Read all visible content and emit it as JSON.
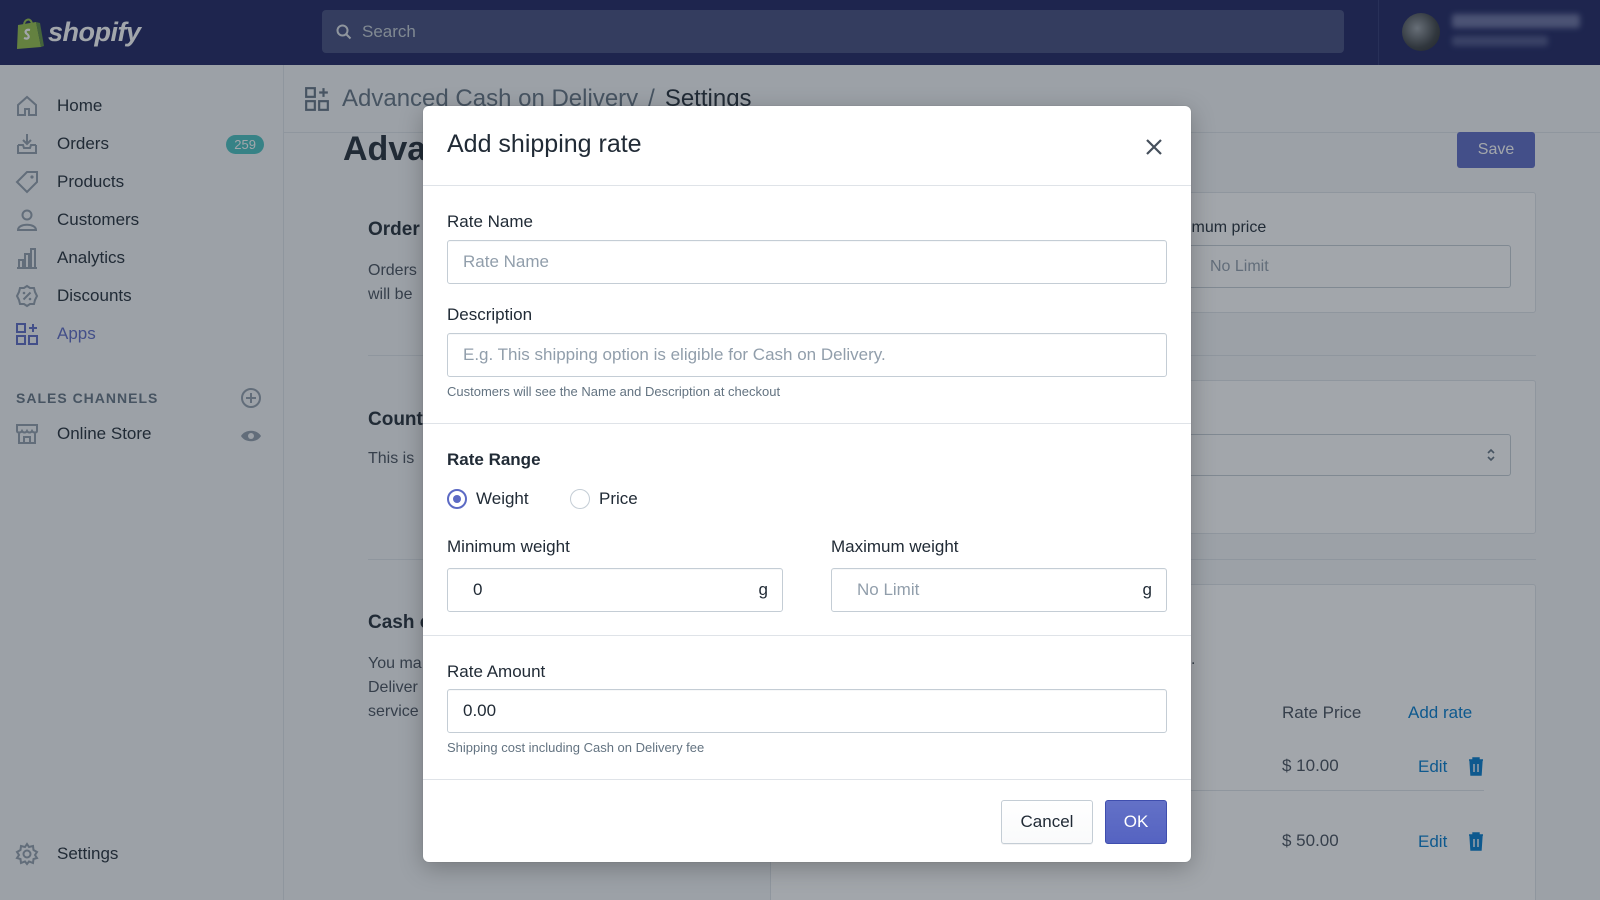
{
  "brand": {
    "name": "shopify"
  },
  "search": {
    "placeholder": "Search"
  },
  "sidebar": {
    "items": [
      {
        "label": "Home",
        "icon": "home-icon"
      },
      {
        "label": "Orders",
        "icon": "orders-icon",
        "badge": "259"
      },
      {
        "label": "Products",
        "icon": "tag-icon"
      },
      {
        "label": "Customers",
        "icon": "customer-icon"
      },
      {
        "label": "Analytics",
        "icon": "analytics-icon"
      },
      {
        "label": "Discounts",
        "icon": "discount-icon"
      },
      {
        "label": "Apps",
        "icon": "apps-icon",
        "active": true
      }
    ],
    "sales_channels_title": "SALES CHANNELS",
    "online_store": "Online Store",
    "settings": "Settings"
  },
  "breadcrumb": {
    "app": "Advanced Cash on Delivery",
    "separator": "/",
    "page": "Settings"
  },
  "background": {
    "title_partial": "Adva",
    "save_label": "Save",
    "order_heading": "Order",
    "order_text_1": "Orders",
    "order_text_2": "will be",
    "max_price_label": "ximum price",
    "max_price_placeholder": "No Limit",
    "country_heading": "Count",
    "country_text": "This is",
    "cash_heading": "Cash o",
    "cash_text_1": "You ma",
    "cash_text_2": "Deliver",
    "cash_text_3": "service",
    "trailing_period": ".",
    "rate_price_header": "Rate Price",
    "add_rate": "Add rate",
    "rates": [
      {
        "price": "$ 10.00",
        "action": "Edit"
      },
      {
        "price": "$ 50.00",
        "action": "Edit"
      }
    ]
  },
  "modal": {
    "title": "Add shipping rate",
    "rate_name_label": "Rate Name",
    "rate_name_placeholder": "Rate Name",
    "description_label": "Description",
    "description_placeholder": "E.g. This shipping option is eligible for Cash on Delivery.",
    "description_help": "Customers will see the Name and Description at checkout",
    "rate_range_label": "Rate Range",
    "range_options": [
      "Weight",
      "Price"
    ],
    "range_selected": "Weight",
    "min_weight_label": "Minimum weight",
    "min_weight_value": "0",
    "max_weight_label": "Maximum weight",
    "max_weight_placeholder": "No Limit",
    "weight_unit": "g",
    "rate_amount_label": "Rate Amount",
    "rate_amount_value": "0.00",
    "rate_amount_help": "Shipping cost including Cash on Delivery fee",
    "cancel_label": "Cancel",
    "ok_label": "OK"
  },
  "colors": {
    "topbar": "#1c2260",
    "accent": "#5c6ac4",
    "badge": "#47c1bf",
    "link": "#007ace"
  }
}
